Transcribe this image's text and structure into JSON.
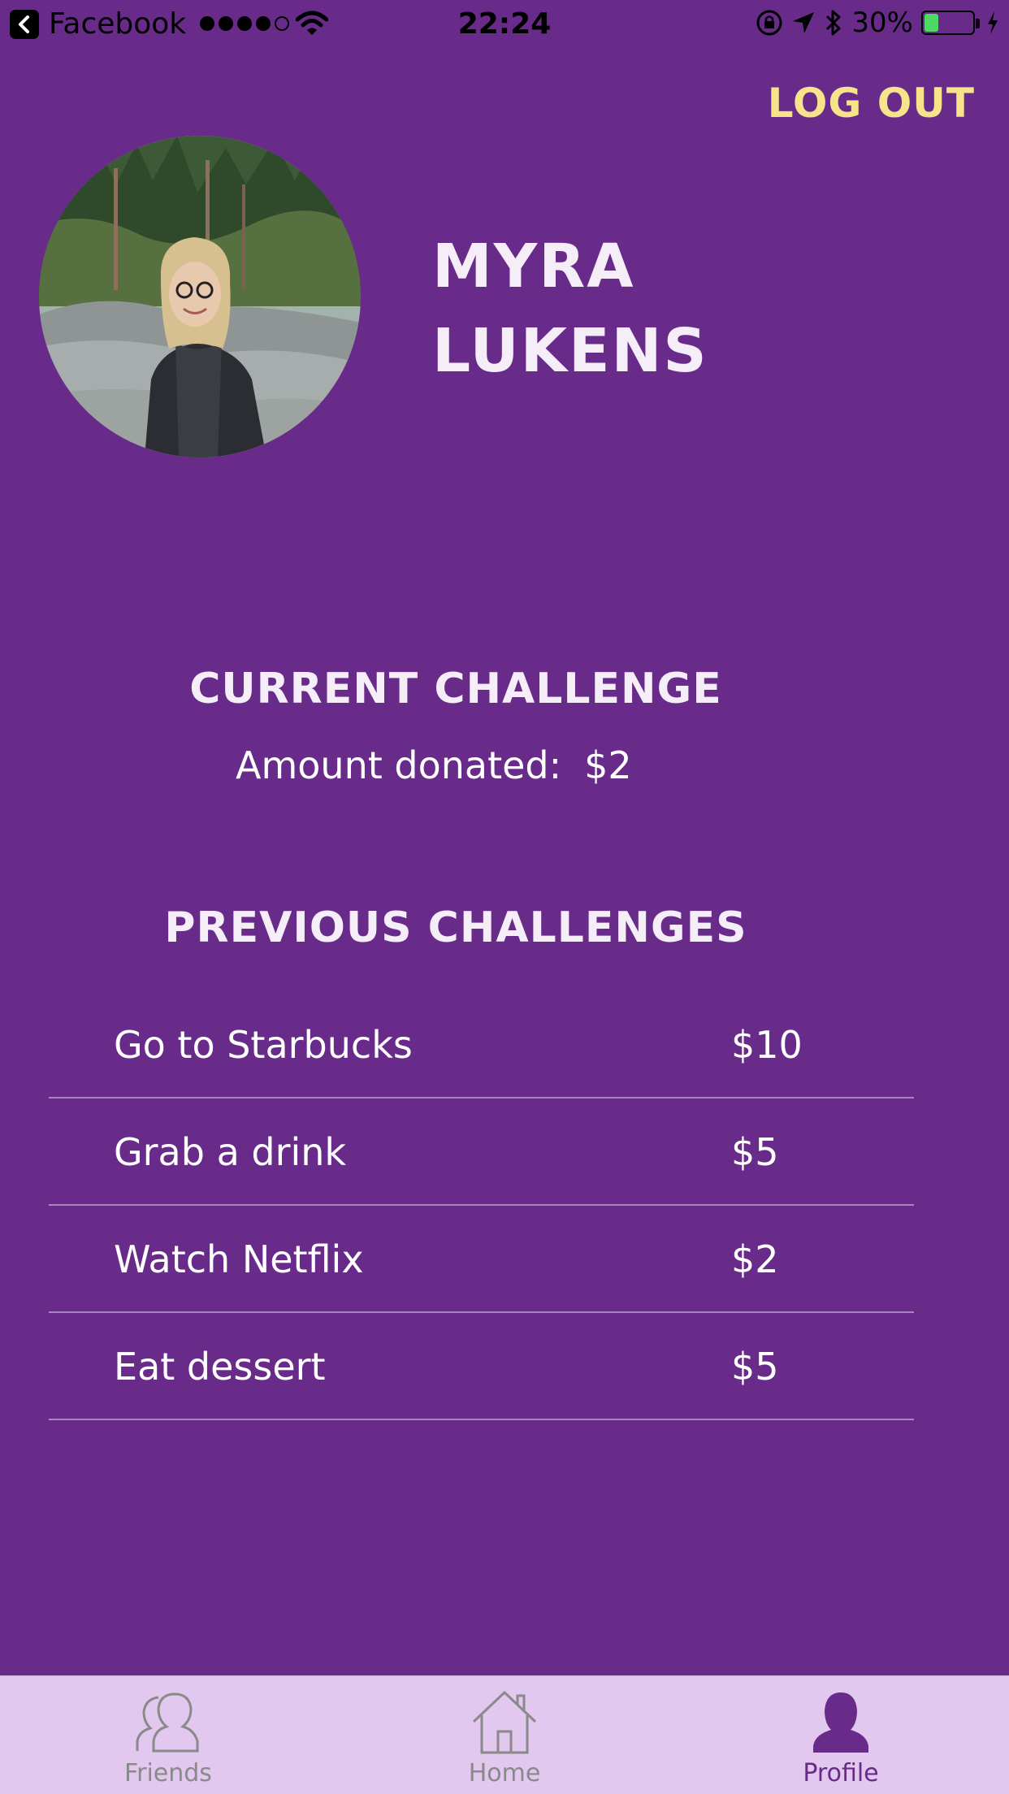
{
  "status_bar": {
    "back_app": "Facebook",
    "time": "22:24",
    "battery_percent": "30%",
    "battery_level": 0.3,
    "signal_bars_filled": 4,
    "signal_bars_total": 5
  },
  "header": {
    "logout_label": "LOG OUT",
    "name_first": "MYRA",
    "name_last": "LUKENS"
  },
  "current_challenge": {
    "title": "CURRENT CHALLENGE",
    "amount_label": "Amount donated:",
    "amount_value": "$2"
  },
  "previous_challenges": {
    "title": "PREVIOUS CHALLENGES",
    "items": [
      {
        "name": "Go to Starbucks",
        "amount": "$10"
      },
      {
        "name": "Grab a drink",
        "amount": "$5"
      },
      {
        "name": "Watch Netflix",
        "amount": "$2"
      },
      {
        "name": "Eat dessert",
        "amount": "$5"
      }
    ]
  },
  "tab_bar": {
    "tabs": [
      {
        "label": "Friends",
        "icon": "friends-icon",
        "active": false
      },
      {
        "label": "Home",
        "icon": "home-icon",
        "active": false
      },
      {
        "label": "Profile",
        "icon": "profile-icon",
        "active": true
      }
    ]
  },
  "colors": {
    "background": "#682B8A",
    "accent_logout": "#F6E38A",
    "tab_bar_bg": "#E2C7EE",
    "tab_active": "#682B8A",
    "tab_inactive": "#8A8A8A"
  }
}
